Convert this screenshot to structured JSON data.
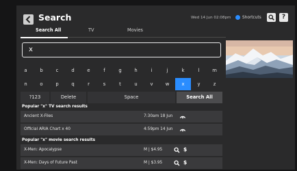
{
  "header": {
    "title": "Search",
    "datetime": "Wed 14 Jun 02:08pm",
    "shortcuts_label": "Shortcuts",
    "help_label": "?"
  },
  "tabs": [
    {
      "label": "Search All",
      "active": true
    },
    {
      "label": "TV",
      "active": false
    },
    {
      "label": "Movies",
      "active": false
    }
  ],
  "search": {
    "query": "x"
  },
  "keyboard": {
    "row1": [
      "a",
      "b",
      "c",
      "d",
      "e",
      "f",
      "g",
      "h",
      "i",
      "j",
      "k",
      "l",
      "m"
    ],
    "row2": [
      "n",
      "o",
      "p",
      "q",
      "r",
      "s",
      "t",
      "u",
      "v",
      "w",
      "x",
      "y",
      "z"
    ],
    "selected_key": "x",
    "bottom": {
      "numeric": "?123",
      "delete": "Delete",
      "space": "Space",
      "search_all": "Search All"
    }
  },
  "tv_results": {
    "heading": "Popular \"x\" TV search results",
    "items": [
      {
        "title": "Ancient X-Files",
        "time": "7:30am 18 Jun",
        "icon": "record-icon"
      },
      {
        "title": "Official ARIA Chart x 40",
        "time": "4:59pm 14 Jun",
        "icon": "record-icon"
      }
    ]
  },
  "movie_results": {
    "heading": "Popular \"x\" movie search results",
    "items": [
      {
        "title": "X-Men: Apocalypse",
        "price": "M | $4.95"
      },
      {
        "title": "X-Men: Days of Future Past",
        "price": "M | $3.95"
      }
    ]
  },
  "colors": {
    "accent": "#2a8dff",
    "panel": "#2a2a2b",
    "row": "#3a3a3c"
  }
}
